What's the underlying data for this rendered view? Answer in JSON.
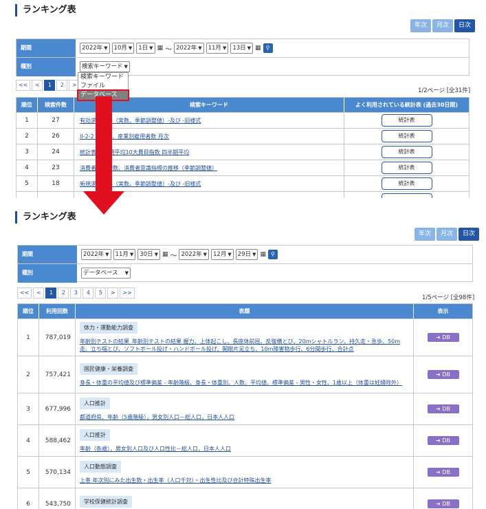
{
  "colors": {
    "accent": "#2456a6",
    "header_bg": "#4a88d0",
    "arrow": "#e01020",
    "db_btn": "#8a6fc8"
  },
  "top": {
    "title": "ランキング表",
    "period_buttons": [
      "年次",
      "月次",
      "日次"
    ],
    "filter": {
      "period_label": "期間",
      "type_label": "種別",
      "from_year": "2022年",
      "from_month": "10月",
      "from_day": "1日",
      "tilde": "〜",
      "to_year": "2022年",
      "to_month": "11月",
      "to_day": "13日",
      "type_value": "検索キーワード"
    },
    "dropdown_options": [
      "検索キーワード",
      "ファイル",
      "データベース"
    ],
    "pager": [
      "<<",
      "<",
      "1",
      "2",
      ">"
    ],
    "page_info": "1/2ページ [全31件]",
    "headers": [
      "順位",
      "検索件数",
      "検索キーワード",
      "よく利用されている統計表 (過去30日間)"
    ],
    "rows": [
      {
        "rank": "1",
        "count": "27",
        "keyword": "有効求人倍率（実数、季節調整値）-及び -旧様式",
        "btn": "統計表"
      },
      {
        "rank": "2",
        "count": "26",
        "keyword": "II-2-2 産業別、産業別雇用者数 月次",
        "btn": "統計表"
      },
      {
        "rank": "3",
        "count": "24",
        "keyword": "統計表 四半期平均10大費目指数 四半期平均",
        "btn": "統計表"
      },
      {
        "rank": "4",
        "count": "23",
        "keyword": "消費者物価指数、消費者意識指標の推移（季節調整値）",
        "btn": "統計表"
      },
      {
        "rank": "5",
        "count": "18",
        "keyword": "新規求人倍率（実数、季節調整値）-及び -旧様式",
        "btn": "統計表"
      }
    ]
  },
  "bottom": {
    "title": "ランキング表",
    "period_buttons": [
      "年次",
      "月次",
      "日次"
    ],
    "filter": {
      "period_label": "期間",
      "type_label": "種別",
      "from_year": "2022年",
      "from_month": "11月",
      "from_day": "30日",
      "tilde": "〜",
      "to_year": "2022年",
      "to_month": "12月",
      "to_day": "29日",
      "type_value": "データベース"
    },
    "pager": [
      "<<",
      "<",
      "1",
      "2",
      "3",
      "4",
      "5",
      ">",
      ">>"
    ],
    "page_info": "1/5ページ [全98件]",
    "headers": [
      "順位",
      "利用回数",
      "表題",
      "表示"
    ],
    "rows": [
      {
        "rank": "1",
        "count": "787,019",
        "tag": "体力・運動能力調査",
        "link": "年齢別テストの結果_年齢別テストの結果 握力、上体起こし、長座体前屈、反復横とび、20mシャトルラン、持久走・急歩、50m走、立ち幅とび、ソフトボール投げ・ハンドボール投げ、開眼片足立ち、10m障害物歩行、6分間歩行、合計点",
        "btn": "DB"
      },
      {
        "rank": "2",
        "count": "757,421",
        "tag": "国民健康・栄養調査",
        "link": "身長・体重の平均値及び標準偏差 - 年齢階級、身長・体重別、人数、平均値、標準偏差 - 男性・女性、1歳以上（体重は妊婦除外）",
        "btn": "DB"
      },
      {
        "rank": "3",
        "count": "677,996",
        "tag": "人口推計",
        "link": "都道府県、年齢（5歳階級），男女別人口－総人口，日本人人口",
        "btn": "DB"
      },
      {
        "rank": "4",
        "count": "588,462",
        "tag": "人口推計",
        "link": "年齢（各歳），男女別人口及び人口性比－総人口，日本人人口",
        "btn": "DB"
      },
      {
        "rank": "5",
        "count": "570,134",
        "tag": "人口動態調査",
        "link": "上巻 年次別にみた出生数・出生率（人口千対）・出生性比及び合計特殊出生率",
        "btn": "DB"
      },
      {
        "rank": "6",
        "count": "543,750",
        "tag": "学校保健統計調査",
        "link": "",
        "btn": "DB"
      }
    ]
  }
}
